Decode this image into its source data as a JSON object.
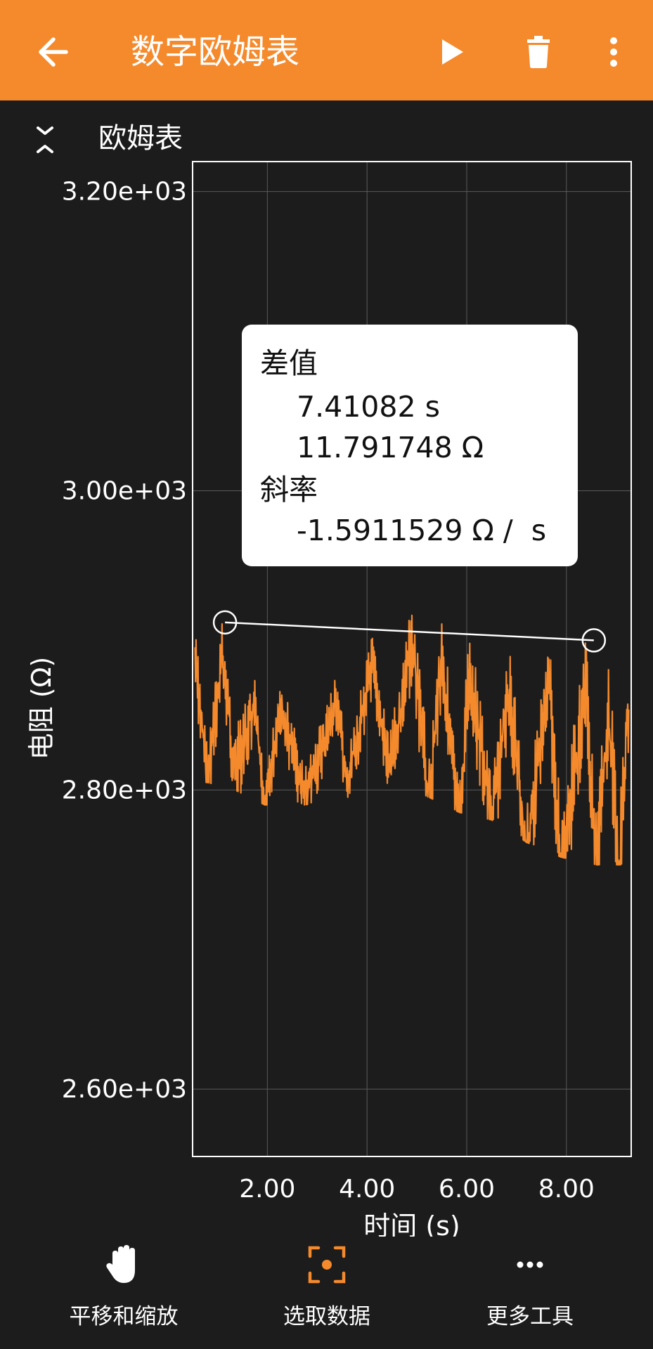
{
  "app_bar": {
    "title": "数字欧姆表",
    "colors": {
      "background": "#f58a2d",
      "foreground": "#ffffff"
    },
    "icons": {
      "back": "arrow-left-icon",
      "run": "play-icon",
      "clear": "trash-icon",
      "menu": "more-vertical-icon"
    }
  },
  "panel": {
    "title": "欧姆表",
    "collapse_icon": "chevron-collapse-icon"
  },
  "chart_data": {
    "type": "line",
    "title": "",
    "xlabel": "时间 (s)",
    "ylabel": "电阻 (Ω)",
    "xlim": [
      0.5,
      9.3
    ],
    "ylim": [
      2555,
      3220
    ],
    "x_ticks": [
      2.0,
      4.0,
      6.0,
      8.0
    ],
    "x_tick_labels": [
      "2.00",
      "4.00",
      "6.00",
      "8.00"
    ],
    "y_ticks": [
      2600,
      2800,
      3000,
      3200
    ],
    "y_tick_labels": [
      "2.60e+03",
      "2.80e+03",
      "3.00e+03",
      "3.20e+03"
    ],
    "grid": true,
    "series": [
      {
        "color": "#f58a2d",
        "peaks_x": [
          0.55,
          1.1,
          1.75,
          2.25,
          3.4,
          4.1,
          4.9,
          5.5,
          6.05,
          6.85,
          7.65,
          8.4,
          8.85,
          9.25
        ],
        "peaks_y": [
          2910,
          2915,
          2875,
          2880,
          2880,
          2905,
          2925,
          2925,
          2915,
          2900,
          2905,
          2910,
          2895,
          2895
        ],
        "troughs_x": [
          0.8,
          1.35,
          1.95,
          2.75,
          3.6,
          4.45,
          5.25,
          5.85,
          6.5,
          7.2,
          7.9,
          8.6,
          9.05
        ],
        "troughs_y": [
          2830,
          2840,
          2800,
          2815,
          2820,
          2835,
          2825,
          2800,
          2810,
          2790,
          2780,
          2780,
          2780
        ],
        "fill_low": [
          2805,
          2800,
          2790,
          2790,
          2795,
          2805,
          2795,
          2785,
          2780,
          2765,
          2755,
          2750,
          2750
        ],
        "fill_high": [
          2890,
          2900,
          2860,
          2870,
          2865,
          2890,
          2905,
          2905,
          2895,
          2880,
          2885,
          2890,
          2880
        ]
      }
    ],
    "selection": {
      "points": [
        {
          "x": 1.15,
          "y": 2912
        },
        {
          "x": 8.55,
          "y": 2900
        }
      ]
    }
  },
  "tooltip": {
    "delta_label": "差值",
    "delta_time": "7.41082 s",
    "delta_value": "11.791748 Ω",
    "slope_label": "斜率",
    "slope_value": "-1.5911529 Ω /  s"
  },
  "bottom_bar": {
    "tools": [
      {
        "label": "平移和缩放",
        "icon": "hand-pan-icon"
      },
      {
        "label": "选取数据",
        "icon": "select-data-icon",
        "accent": "#f58a2d"
      },
      {
        "label": "更多工具",
        "icon": "more-horizontal-icon"
      }
    ]
  }
}
